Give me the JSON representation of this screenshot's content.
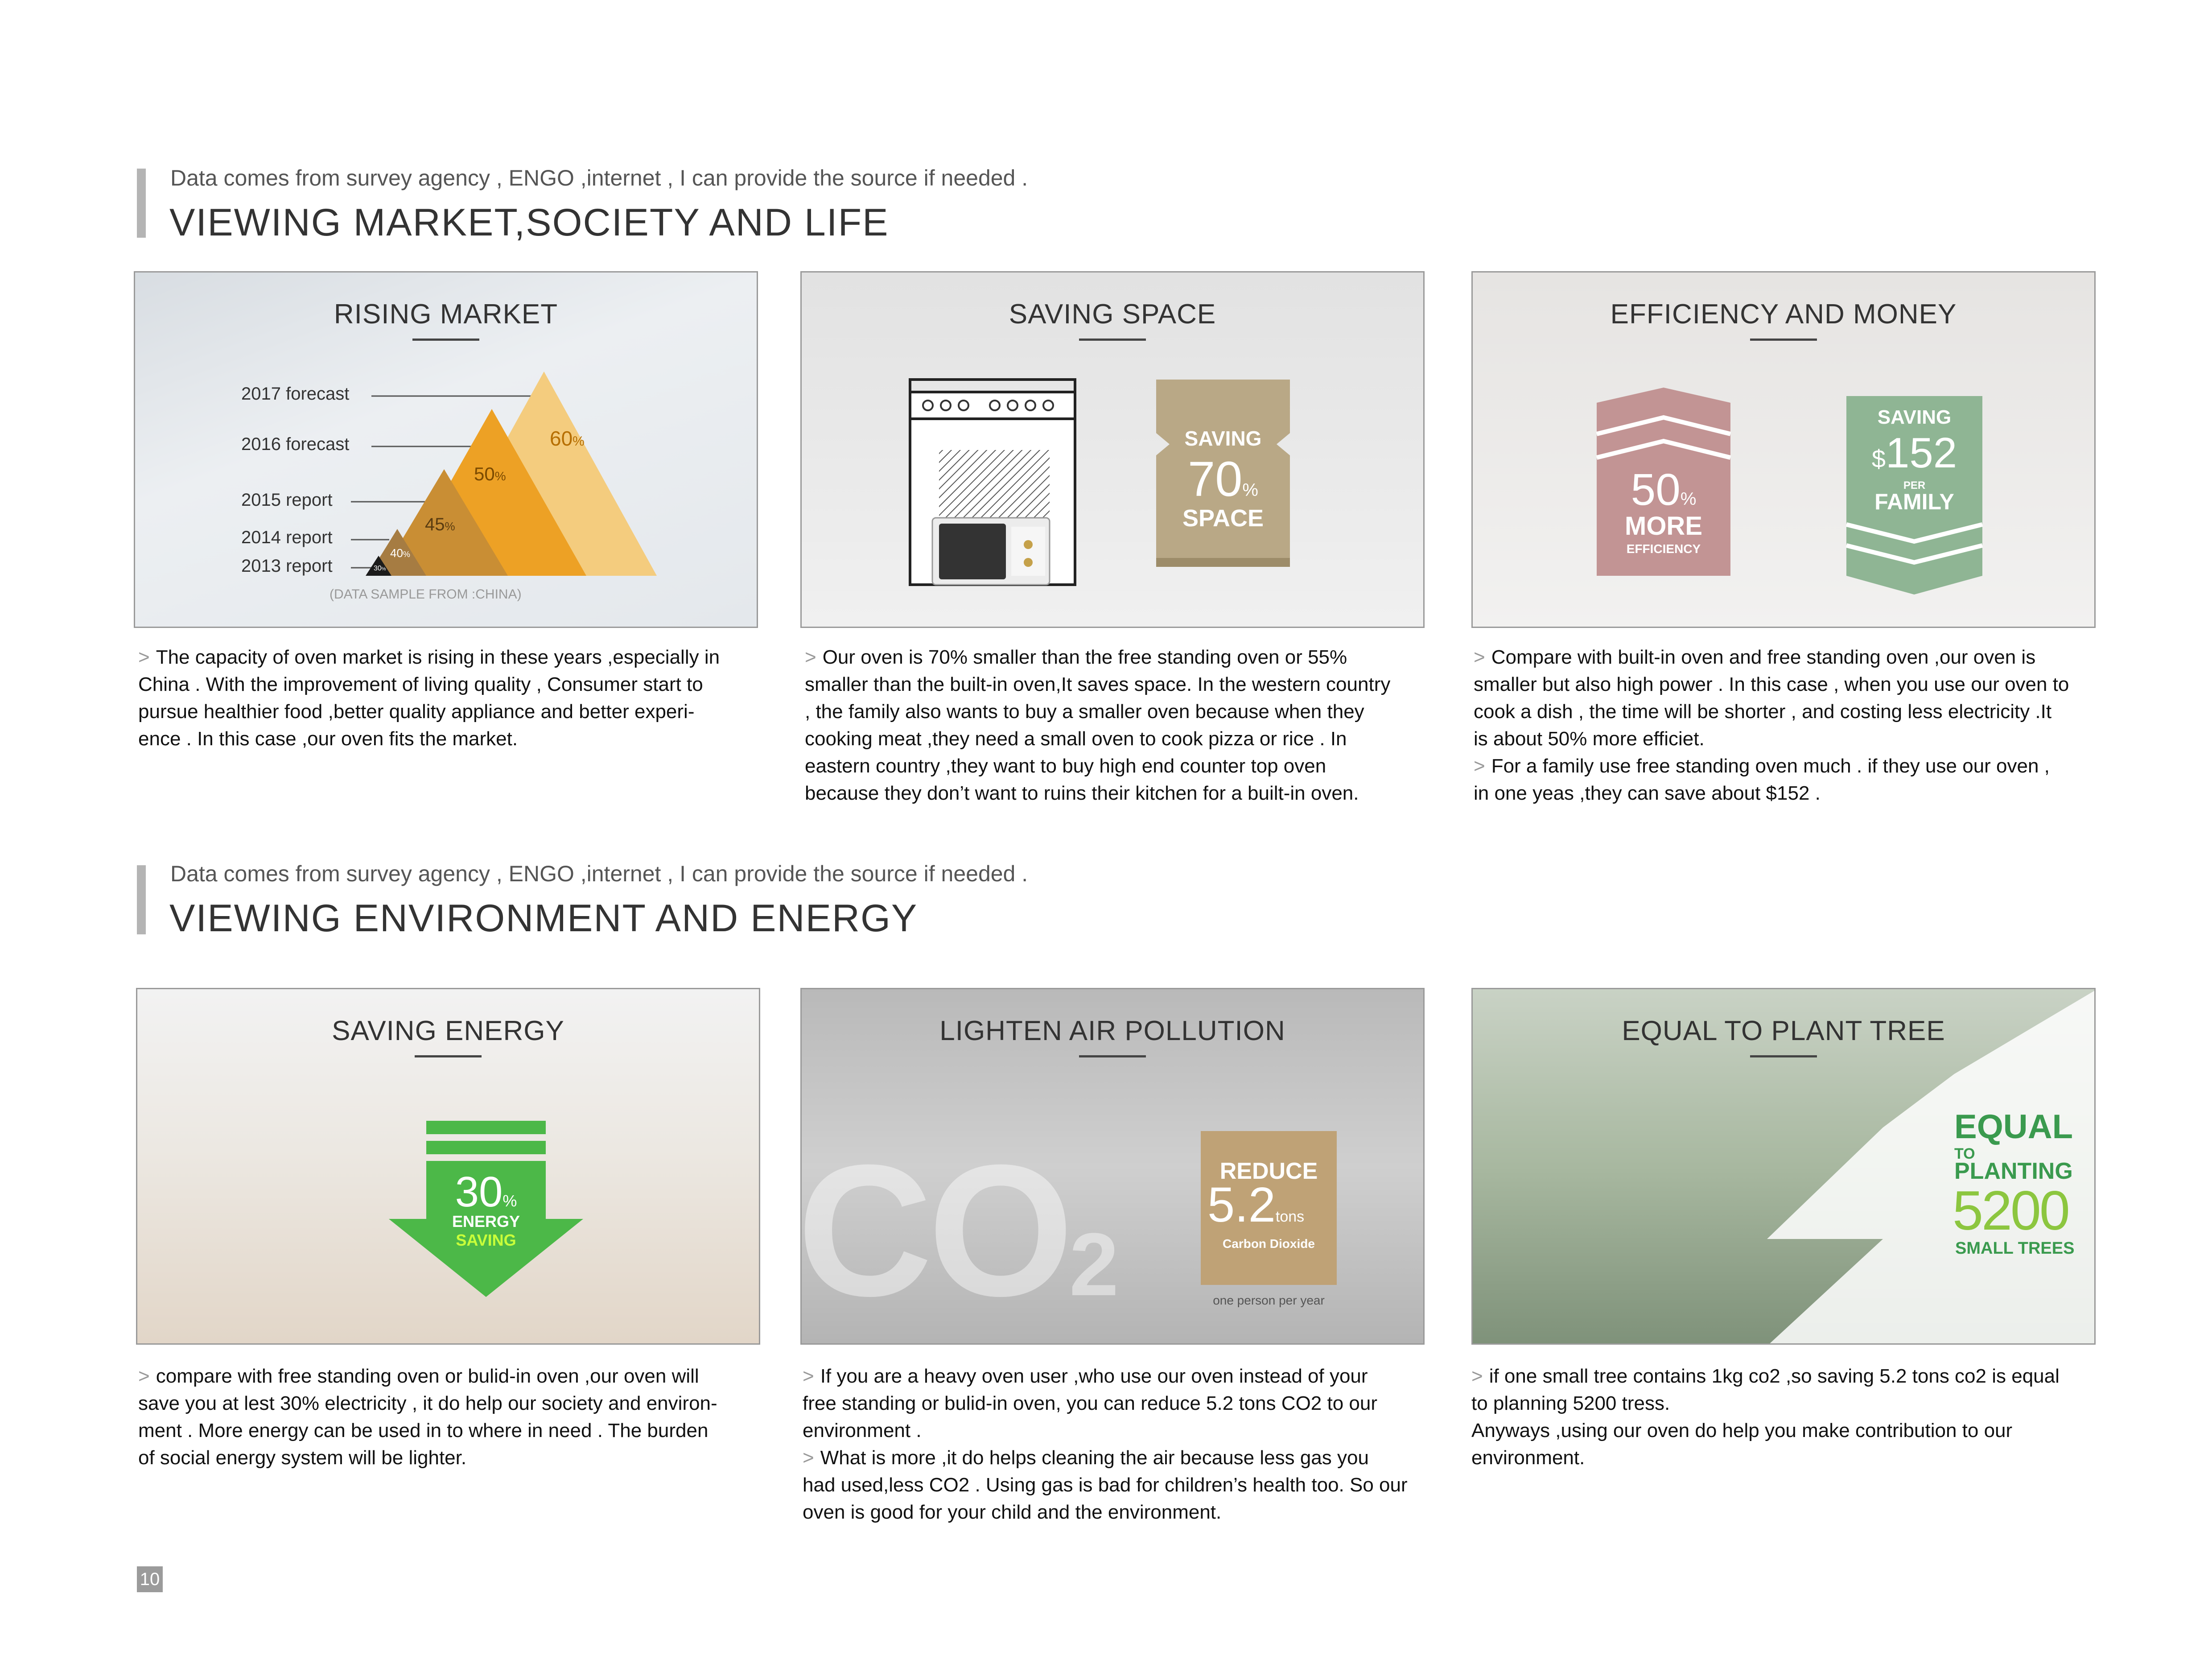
{
  "sections": [
    {
      "subtitle": "Data comes from survey agency , ENGO ,internet , I can provide the source if needed .",
      "title": "VIEWING MARKET,SOCIETY AND LIFE"
    },
    {
      "subtitle": "Data comes from survey agency , ENGO ,internet , I can provide the source if needed .",
      "title": "VIEWING ENVIRONMENT AND ENERGY"
    }
  ],
  "panels": {
    "rising": {
      "title": "RISING MARKET",
      "labels": [
        "2017 forecast",
        "2016 forecast",
        "2015 report",
        "2014 report",
        "2013 report"
      ],
      "pct": [
        "60",
        "50",
        "45",
        "40",
        "30"
      ],
      "pct_unit": "%",
      "note": "(DATA SAMPLE FROM :CHINA)"
    },
    "space": {
      "title": "SAVING SPACE",
      "l1": "SAVING",
      "num": "70",
      "unit": "%",
      "l2": "SPACE"
    },
    "efficiency": {
      "title": "EFFICIENCY AND MONEY",
      "pct": "50",
      "unit": "%",
      "more": "MORE",
      "eff": "EFFICIENCY",
      "saving": "SAVING",
      "dollar": "$",
      "amount": "152",
      "per": "PER",
      "family": "FAMILY"
    },
    "energy": {
      "title": "SAVING ENERGY",
      "num": "30",
      "unit": "%",
      "l1": "ENERGY",
      "l2": "SAVING"
    },
    "pollution": {
      "title": "LIGHTEN AIR POLLUTION",
      "co2_main": "CO",
      "co2_sub": "2",
      "reduce": "REDUCE",
      "num": "5.2",
      "unit": "tons",
      "label": "Carbon Dioxide",
      "note": "one person per year"
    },
    "tree": {
      "title": "EQUAL TO PLANT TREE",
      "equal": "EQUAL",
      "to": "TO",
      "planting": "PLANTING",
      "num": "5200",
      "trees": "SMALL TREES"
    }
  },
  "texts": {
    "rising": [
      "The capacity of oven market is rising in these years ,especially in",
      "China . With the improvement of living quality , Consumer start to",
      "pursue healthier food ,better quality appliance and better experi-",
      "ence . In this case ,our oven fits the market."
    ],
    "space": [
      "Our oven is 70% smaller than the free standing oven or 55%",
      "smaller than the built-in oven,It saves space. In the western country",
      ", the family also wants to buy a smaller oven because when they",
      "cooking meat ,they need a small oven to cook pizza or rice . In",
      "eastern country ,they want to buy high end counter top oven",
      "because they don’t want to ruins their kitchen for a built-in oven."
    ],
    "efficiency": [
      "Compare with built-in oven and free standing oven ,our oven is",
      "smaller but also high power . In this case , when you use our oven to",
      "cook a dish , the time will be shorter , and costing less  electricity .It",
      "is about 50% more efficiet.",
      "For a  family use free standing oven much . if they use our oven ,",
      "in one yeas ,they can save about $152 ."
    ],
    "energy": [
      "compare with free standing oven or bulid-in oven ,our oven will",
      "save you at lest 30% electricity , it do help our society and environ-",
      "ment .  More energy can be used in to where in need . The burden",
      "of social energy system will be lighter."
    ],
    "pollution": [
      "If you are a heavy oven user ,who use our oven instead of your",
      "free standing or bulid-in oven, you can reduce 5.2 tons CO2 to our",
      "environment .",
      "What is more ,it do helps cleaning the air because less gas you",
      "had used,less CO2 . Using gas is bad for children’s health too. So our",
      "oven is good for your child and the environment."
    ],
    "tree": [
      "if one small tree contains 1kg co2 ,so saving 5.2 tons co2 is equal",
      "to planning 5200 tress.",
      "Anyways ,using our oven do help you make contribution to our",
      "environment."
    ]
  },
  "arrow": ">",
  "page_number": "10"
}
